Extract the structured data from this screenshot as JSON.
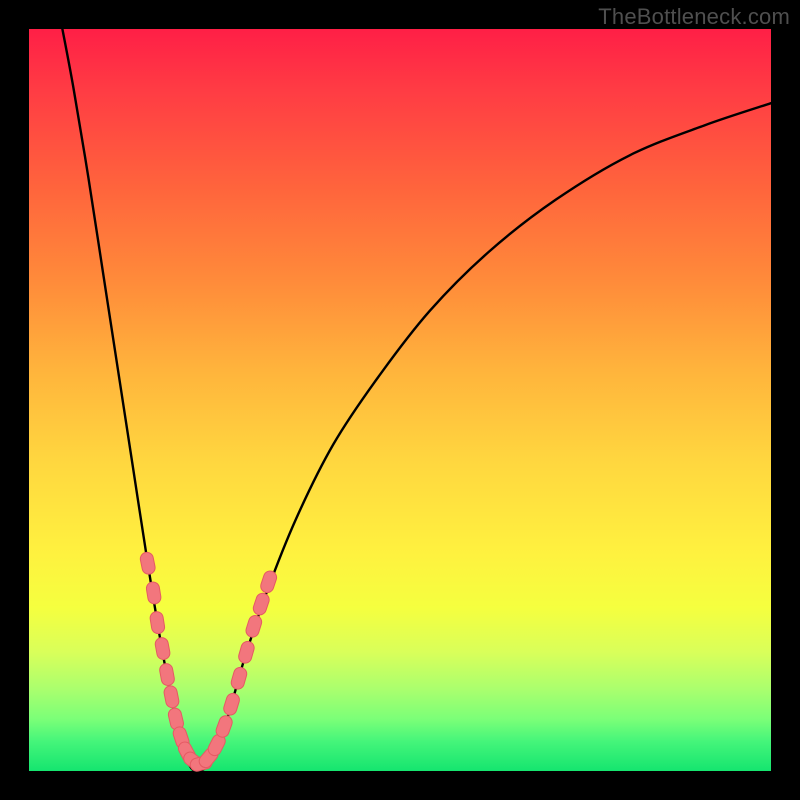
{
  "watermark": "TheBottleneck.com",
  "colors": {
    "curve": "#000000",
    "marker_fill": "#f2767d",
    "marker_stroke": "#e55a63",
    "gradient_top": "#ff1f46",
    "gradient_bottom": "#15e56f",
    "frame": "#000000"
  },
  "chart_data": {
    "type": "line",
    "title": "",
    "xlabel": "",
    "ylabel": "",
    "xlim": [
      0,
      100
    ],
    "ylim": [
      0,
      100
    ],
    "legend": false,
    "grid": false,
    "curve_note": "V-shaped bottleneck curve; y≈0 at trough near x≈22, rises sharply both sides",
    "curve_points": [
      {
        "x": 4.5,
        "y": 100
      },
      {
        "x": 6,
        "y": 92
      },
      {
        "x": 8,
        "y": 80
      },
      {
        "x": 10,
        "y": 67
      },
      {
        "x": 12,
        "y": 54
      },
      {
        "x": 14,
        "y": 41
      },
      {
        "x": 16,
        "y": 28
      },
      {
        "x": 18,
        "y": 16
      },
      {
        "x": 20,
        "y": 6
      },
      {
        "x": 21.5,
        "y": 1
      },
      {
        "x": 23,
        "y": 0
      },
      {
        "x": 25,
        "y": 2
      },
      {
        "x": 27,
        "y": 8
      },
      {
        "x": 29,
        "y": 15
      },
      {
        "x": 32,
        "y": 24
      },
      {
        "x": 36,
        "y": 34
      },
      {
        "x": 41,
        "y": 44
      },
      {
        "x": 47,
        "y": 53
      },
      {
        "x": 54,
        "y": 62
      },
      {
        "x": 62,
        "y": 70
      },
      {
        "x": 71,
        "y": 77
      },
      {
        "x": 81,
        "y": 83
      },
      {
        "x": 91,
        "y": 87
      },
      {
        "x": 100,
        "y": 90
      }
    ],
    "markers_note": "Pink rounded-capsule markers clustered around the trough",
    "markers": [
      {
        "x": 16.0,
        "y": 28.0
      },
      {
        "x": 16.8,
        "y": 24.0
      },
      {
        "x": 17.3,
        "y": 20.0
      },
      {
        "x": 18.0,
        "y": 16.5
      },
      {
        "x": 18.6,
        "y": 13.0
      },
      {
        "x": 19.2,
        "y": 10.0
      },
      {
        "x": 19.8,
        "y": 7.0
      },
      {
        "x": 20.5,
        "y": 4.5
      },
      {
        "x": 21.3,
        "y": 2.5
      },
      {
        "x": 22.2,
        "y": 1.3
      },
      {
        "x": 23.2,
        "y": 1.0
      },
      {
        "x": 24.2,
        "y": 1.8
      },
      {
        "x": 25.3,
        "y": 3.5
      },
      {
        "x": 26.3,
        "y": 6.0
      },
      {
        "x": 27.3,
        "y": 9.0
      },
      {
        "x": 28.3,
        "y": 12.5
      },
      {
        "x": 29.3,
        "y": 16.0
      },
      {
        "x": 30.3,
        "y": 19.5
      },
      {
        "x": 31.3,
        "y": 22.5
      },
      {
        "x": 32.3,
        "y": 25.5
      }
    ]
  }
}
